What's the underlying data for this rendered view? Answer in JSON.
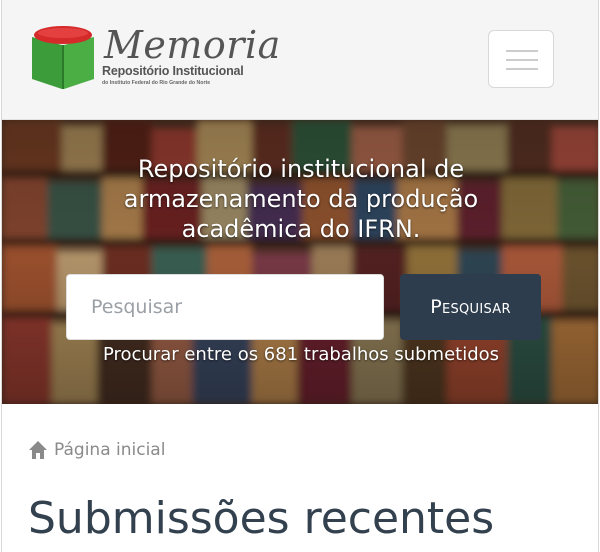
{
  "header": {
    "logo": {
      "title": "Memoria",
      "subtitle": "Repositório Institucional",
      "tagline": "do Instituto Federal do Rio Grande do Norte"
    },
    "menu_icon": "hamburger-icon"
  },
  "hero": {
    "headline_line1": "Repositório institucional de",
    "headline_line2": "armazenamento da produção",
    "headline_line3": "acadêmica do IFRN.",
    "search": {
      "placeholder": "Pesquisar",
      "value": "",
      "button_label": "Pesquisar"
    },
    "count_text": "Procurar entre os 681 trabalhos submetidos"
  },
  "breadcrumb": {
    "icon": "home-icon",
    "label": "Página inicial"
  },
  "main": {
    "section_title": "Submissões recentes"
  },
  "colors": {
    "brand_green": "#3a9a3a",
    "brand_red": "#d42a2a",
    "button_bg": "#2e3d4d",
    "title_color": "#33414f"
  }
}
